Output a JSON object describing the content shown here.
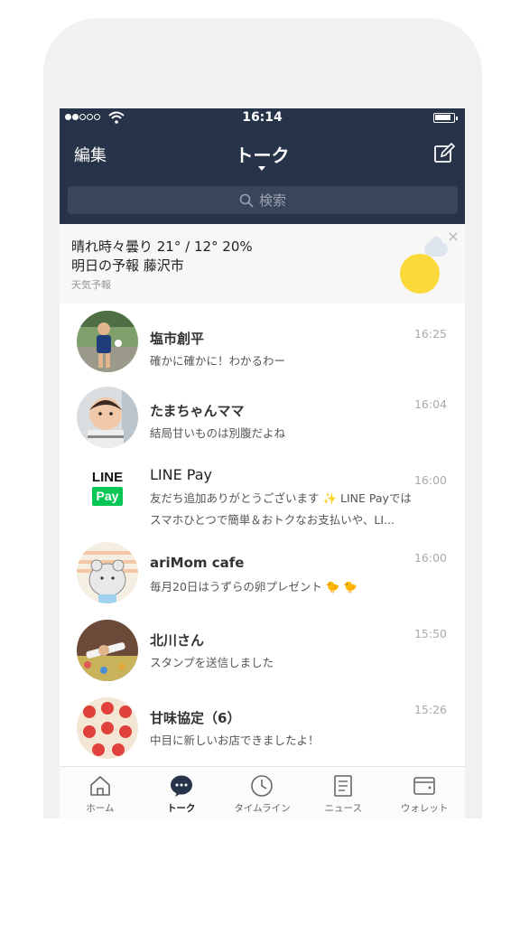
{
  "status_bar": {
    "time": "16:14"
  },
  "header": {
    "edit_label": "編集",
    "title": "トーク",
    "search_placeholder": "検索"
  },
  "weather": {
    "line1": "晴れ時々曇り 21° / 12° 20%",
    "line2": "明日の予報 藤沢市",
    "source": "天気予報",
    "close": "×"
  },
  "chats": [
    {
      "name": "塩市創平",
      "message": "確かに確かに！わかるわー",
      "time": "16:25"
    },
    {
      "name": "たまちゃんママ",
      "message": "結局甘いものは別腹だよね",
      "time": "16:04"
    },
    {
      "name": "LINE Pay",
      "message": "友だち追加ありがとうございます ✨ LINE Payではスマホひとつで簡単＆おトクなお支払いや、LI...",
      "time": "16:00",
      "logo_top": "LINE",
      "logo_bottom": "Pay"
    },
    {
      "name": "ariMom cafe",
      "message": "毎月20日はうずらの卵プレゼント 🐤 🐤",
      "time": "16:00"
    },
    {
      "name": "北川さん",
      "message": "スタンプを送信しました",
      "time": "15:50"
    },
    {
      "name": "甘味協定（6）",
      "message": "中目に新しいお店できましたよ！",
      "time": "15:26"
    }
  ],
  "tabs": [
    {
      "label": "ホーム",
      "icon": "home-icon"
    },
    {
      "label": "トーク",
      "icon": "chat-bubble-icon",
      "active": true
    },
    {
      "label": "タイムライン",
      "icon": "clock-icon"
    },
    {
      "label": "ニュース",
      "icon": "news-icon"
    },
    {
      "label": "ウォレット",
      "icon": "wallet-icon"
    }
  ],
  "colors": {
    "header_bg": "#273349",
    "line_green": "#06c755",
    "sun": "#fbd93a"
  }
}
